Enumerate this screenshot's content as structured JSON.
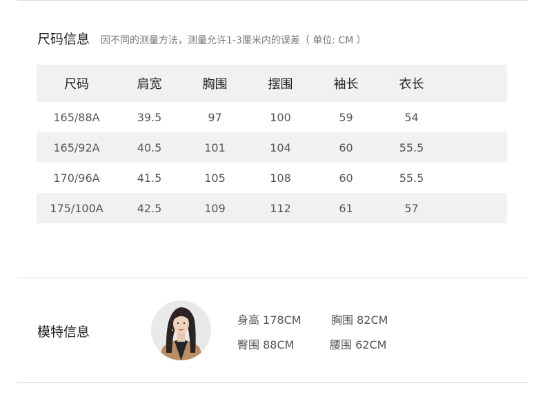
{
  "size_section": {
    "title": "尺码信息",
    "note": "因不同的测量方法，测量允许1-3厘米内的误差（ 单位: CM ）",
    "columns": [
      "尺码",
      "肩宽",
      "胸围",
      "摆围",
      "袖长",
      "衣长"
    ],
    "rows": [
      [
        "165/88A",
        "39.5",
        "97",
        "100",
        "59",
        "54"
      ],
      [
        "165/92A",
        "40.5",
        "101",
        "104",
        "60",
        "55.5"
      ],
      [
        "170/96A",
        "41.5",
        "105",
        "108",
        "60",
        "55.5"
      ],
      [
        "175/100A",
        "42.5",
        "109",
        "112",
        "61",
        "57"
      ]
    ]
  },
  "model_section": {
    "title": "模特信息",
    "avatar_icon": "model-portrait",
    "height": "身高 178CM",
    "bust": "胸围 82CM",
    "hip": "臀围 88CM",
    "waist": "腰围 62CM"
  }
}
